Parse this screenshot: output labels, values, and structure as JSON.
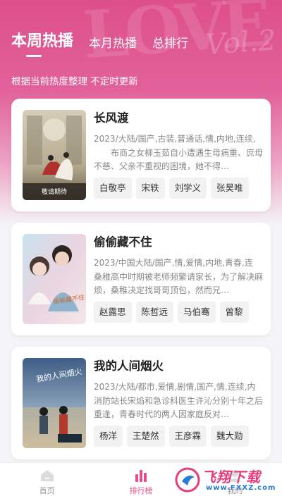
{
  "header": {
    "tabs": [
      {
        "label": "本周热播",
        "active": true
      },
      {
        "label": "本月热播",
        "active": false
      },
      {
        "label": "总排行",
        "active": false
      }
    ],
    "subtitle": "根据当前热度整理 不定时更新",
    "deco_text": "LOVE",
    "deco_script": "Vol.2"
  },
  "cards": [
    {
      "title": "长风渡",
      "tags": "2023/大陆/国产,古装,普通话,情,内地,连续,",
      "description": "布商之女柳玉茹自小遭遇生母病重、庶母不慈、父亲不重视的困境，她不得…",
      "cast": [
        "白敬亭",
        "宋轶",
        "刘学义",
        "张昊唯"
      ],
      "poster_caption": "敬请期待"
    },
    {
      "title": "偷偷藏不住",
      "tags": "2023/中国大陆/国产,情,爱情,内地,青春,连",
      "description": "桑稚高中时期被老师频繁请家长，为了解决麻烦，桑稚决定找哥哥顶包，然而兄…",
      "cast": [
        "赵露思",
        "陈哲远",
        "马伯骞",
        "曾黎"
      ],
      "poster_caption": "偷偷藏不住"
    },
    {
      "title": "我的人间烟火",
      "tags": "2023/大陆/都市,爱情,剧情,国产,情,连续,内",
      "description": "消防站长宋焰和急诊科医生许沁分别十年之后重逢，青春时代的两人因家庭反对…",
      "cast": [
        "杨洋",
        "王楚然",
        "王彦霖",
        "魏大勋"
      ],
      "poster_caption": "我的人间烟火"
    }
  ],
  "tabbar": {
    "items": [
      {
        "label": "首页",
        "icon": "home-icon",
        "active": false
      },
      {
        "label": "排行榜",
        "icon": "chart-icon",
        "active": true
      },
      {
        "label": "我的",
        "icon": "profile-icon",
        "active": false
      }
    ]
  },
  "watermark": {
    "main": "飞翔下载",
    "url": "www.FXXZ.com"
  },
  "colors": {
    "accent": "#e04f8b",
    "hero_top": "#dd4f8a"
  }
}
